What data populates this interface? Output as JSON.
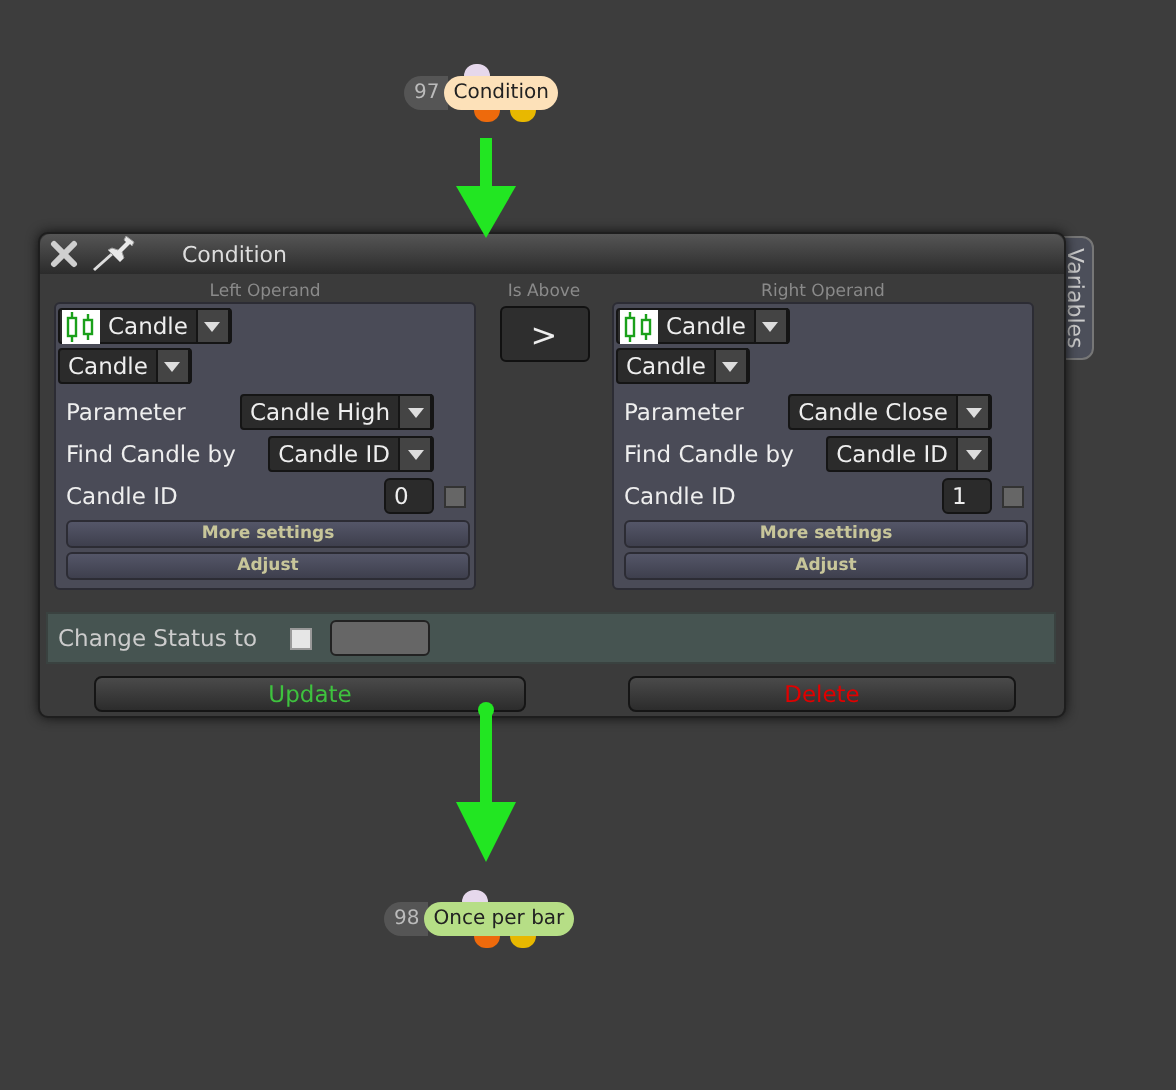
{
  "nodes": [
    {
      "number": "97",
      "label": "Condition",
      "color": "#fde1b9"
    },
    {
      "number": "98",
      "label": "Once per bar",
      "color": "#b6de86"
    }
  ],
  "window": {
    "title": "Condition"
  },
  "side_tab": "Variables",
  "comparator": {
    "label": "Is Above",
    "symbol": ">"
  },
  "operands": [
    {
      "heading": "Left Operand",
      "source": "Candle",
      "type": "Candle",
      "fields": [
        {
          "kind": "dropdown",
          "label": "Parameter",
          "value": "Candle High"
        },
        {
          "kind": "dropdown",
          "label": "Find Candle by",
          "value": "Candle ID"
        },
        {
          "kind": "number",
          "label": "Candle ID",
          "value": "0",
          "checked": false
        }
      ],
      "buttons": [
        "More settings",
        "Adjust"
      ]
    },
    {
      "heading": "Right Operand",
      "source": "Candle",
      "type": "Candle",
      "fields": [
        {
          "kind": "dropdown",
          "label": "Parameter",
          "value": "Candle Close"
        },
        {
          "kind": "dropdown",
          "label": "Find Candle by",
          "value": "Candle ID"
        },
        {
          "kind": "number",
          "label": "Candle ID",
          "value": "1",
          "checked": false
        }
      ],
      "buttons": [
        "More settings",
        "Adjust"
      ]
    }
  ],
  "status": {
    "label": "Change Status to",
    "checked": false
  },
  "actions": [
    {
      "label": "Update",
      "kind": "confirm"
    },
    {
      "label": "Delete",
      "kind": "danger"
    }
  ]
}
